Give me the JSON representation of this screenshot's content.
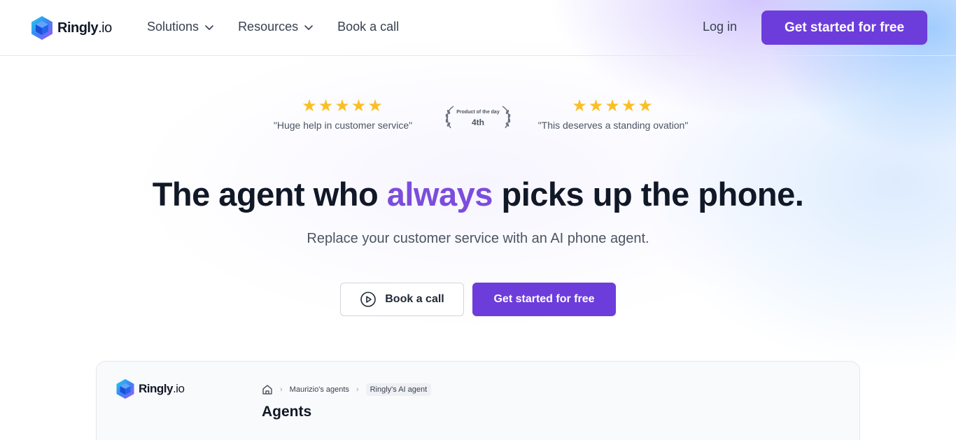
{
  "header": {
    "logo_text": "Ringly",
    "logo_suffix": ".io",
    "nav": [
      {
        "label": "Solutions",
        "has_dropdown": true
      },
      {
        "label": "Resources",
        "has_dropdown": true
      },
      {
        "label": "Book a call",
        "has_dropdown": false
      }
    ],
    "login_label": "Log in",
    "cta_label": "Get started for free"
  },
  "reviews": {
    "left": {
      "stars": "★★★★★",
      "quote": "\"Huge help in customer service\""
    },
    "award": {
      "label": "Product of the day",
      "rank": "4th"
    },
    "right": {
      "stars": "★★★★★",
      "quote": "\"This deserves a standing ovation\""
    }
  },
  "hero": {
    "title_before": "The agent who ",
    "title_accent": "always",
    "title_after": " picks up the phone.",
    "subtitle": "Replace your customer service with an AI phone agent.",
    "btn_secondary": "Book a call",
    "btn_primary": "Get started for free"
  },
  "preview": {
    "logo_text": "Ringly",
    "logo_suffix": ".io",
    "breadcrumb": [
      "Maurizio's agents",
      "Ringly's AI agent"
    ],
    "title": "Agents"
  },
  "colors": {
    "accent": "#6d3ddc",
    "accent_text": "#7c4ddc",
    "star": "#fbbf24"
  }
}
